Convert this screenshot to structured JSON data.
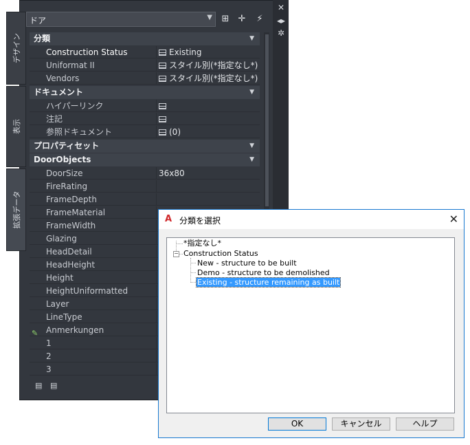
{
  "palette": {
    "style_value": "ドア",
    "tabs": [
      "デザイン",
      "表示",
      "拡張データ"
    ],
    "categories": [
      {
        "label": "分類",
        "rows": [
          {
            "name": "Construction Status",
            "value": "Existing",
            "icon": true
          },
          {
            "name": "Uniformat II",
            "value": "スタイル別(*指定なし*)",
            "icon": true
          },
          {
            "name": "Vendors",
            "value": "スタイル別(*指定なし*)",
            "icon": true
          }
        ]
      },
      {
        "label": "ドキュメント",
        "rows": [
          {
            "name": "ハイパーリンク",
            "value": "",
            "icon": true
          },
          {
            "name": "注記",
            "value": "",
            "icon": true
          },
          {
            "name": "参照ドキュメント",
            "value": "(0)",
            "icon": true
          }
        ]
      },
      {
        "label": "プロパティセット",
        "rows": []
      },
      {
        "label": "DoorObjects",
        "rows": [
          {
            "name": "DoorSize",
            "value": "36x80"
          },
          {
            "name": "FireRating",
            "value": ""
          },
          {
            "name": "FrameDepth",
            "value": ""
          },
          {
            "name": "FrameMaterial",
            "value": ""
          },
          {
            "name": "FrameWidth",
            "value": ""
          },
          {
            "name": "Glazing",
            "value": ""
          },
          {
            "name": "HeadDetail",
            "value": ""
          },
          {
            "name": "HeadHeight",
            "value": ""
          },
          {
            "name": "Height",
            "value": ""
          },
          {
            "name": "HeightUniformatted",
            "value": ""
          },
          {
            "name": "Layer",
            "value": ""
          },
          {
            "name": "LineType",
            "value": ""
          },
          {
            "name": "Anmerkungen",
            "value": ""
          },
          {
            "name": "1",
            "value": ""
          },
          {
            "name": "2",
            "value": ""
          },
          {
            "name": "3",
            "value": ""
          }
        ]
      }
    ]
  },
  "dialog": {
    "logo": "A",
    "title": "分類を選択",
    "tree": {
      "root_none": "*指定なし*",
      "group": "Construction Status",
      "items": [
        "New - structure to be built",
        "Demo - structure to be demolished",
        "Existing - structure remaining as built"
      ]
    },
    "buttons": {
      "ok": "OK",
      "cancel": "キャンセル",
      "help": "ヘルプ"
    }
  }
}
